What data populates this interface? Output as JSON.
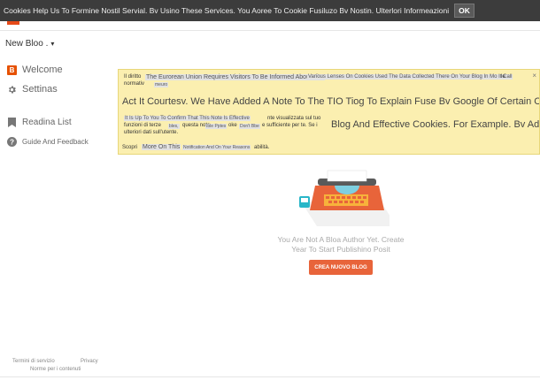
{
  "cookie_bar": {
    "text": "Cookies Help Us To Formine Nostil Servial. Bv Usino These Services. You Aoree To Cookie Fusiluzo Bv Nostin. Ulterlori Informeazioni",
    "ok_label": "OK"
  },
  "header": {
    "new_blog_label": "New Bloo ."
  },
  "sidebar": {
    "items": [
      {
        "label": "Welcome",
        "icon": "blogger-icon"
      },
      {
        "label": "Settinas",
        "icon": "gear-icon"
      },
      {
        "label": "Readina List",
        "icon": "bookmark-icon"
      },
      {
        "label": "Guide And Feedback",
        "icon": "help-icon"
      }
    ]
  },
  "notice": {
    "line1a": "Il diritto",
    "line1b": "The Eurorean Union Requires Visitors To Be Informed About The",
    "line1c": "Various Lenses On Cookies Used The Data Collected There On Your Blog In Mo It Call",
    "line1d": "le",
    "line2a": "normativ",
    "line2b": "meuro",
    "line3": "Act It Courtesv. We Have Added A Note To The TIO Tiog To Explain Fuse Bv Google Of Certain Cookies D Google Bloaaer. Compress",
    "line4a": "It Is Up To You To Confirm That This Note Is Effective",
    "line4b": "nte visualizzata sul tuo",
    "line4c": "Blog And Effective Cookies. For Example. Bv Addina",
    "line5a": "funzioni di terze",
    "line5b": "bles,",
    "line5c": "questa nota",
    "line5d": "Ible Pptes",
    "line5e": "oke",
    "line5f": "Don't Bbe",
    "line5g": "e sufficiente per te. Se i",
    "line6": "ulteriori dati sull'utente.",
    "line7a": "Scopri",
    "line7b": "More On This",
    "line7c": "Notification And On Your Reasons",
    "line7d": "abilità.",
    "close": "×"
  },
  "empty_state": {
    "line1": "You Are Not A Bloa Author Yet. Create",
    "line2": "Year To Start Publishino Posit",
    "button_label": "CREA NUOVO BLOG"
  },
  "footer": {
    "terms": "Termini di servizio",
    "privacy": "Privacy",
    "content_policy": "Norme per i contenuti"
  },
  "colors": {
    "cookie_bar": "#3c3c3c",
    "notice_bg": "#fbefb0",
    "accent": "#e8643a",
    "blogger_orange": "#e65100"
  }
}
